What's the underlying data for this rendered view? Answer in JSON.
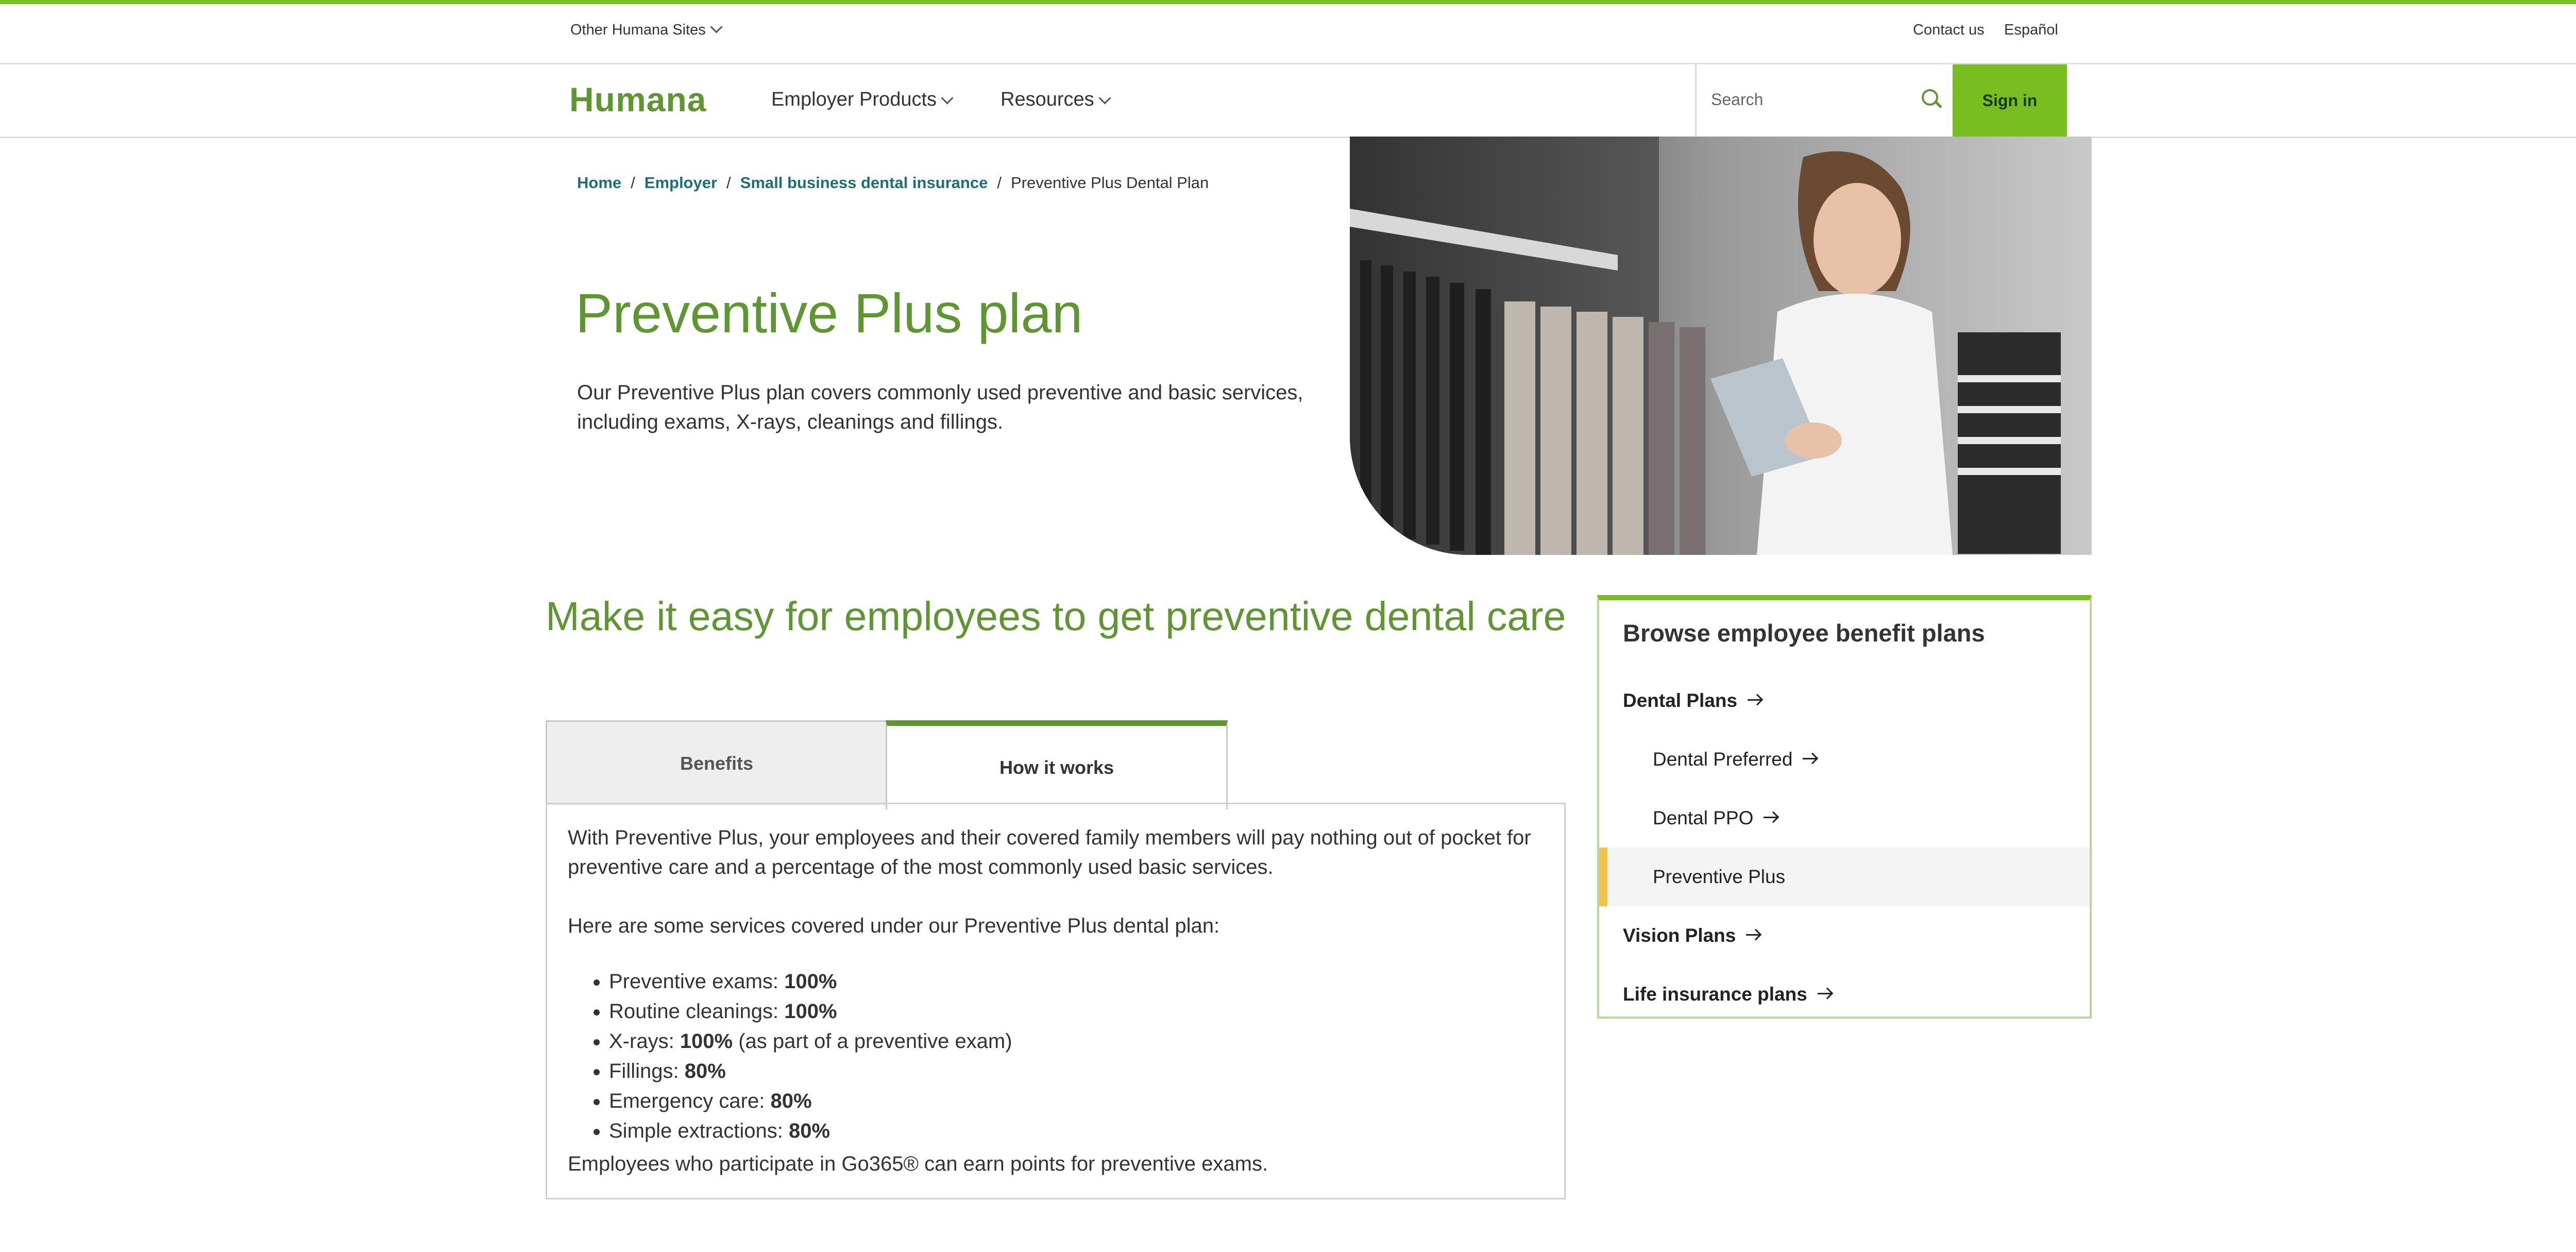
{
  "utility": {
    "other_sites": "Other Humana Sites",
    "contact": "Contact us",
    "language": "Español"
  },
  "nav": {
    "logo": "Humana",
    "employer_products": "Employer Products",
    "resources": "Resources",
    "search_placeholder": "Search",
    "sign_in": "Sign in"
  },
  "breadcrumb": {
    "home": "Home",
    "employer": "Employer",
    "small_business": "Small business dental insurance",
    "current": "Preventive Plus Dental Plan",
    "sep": "/"
  },
  "hero": {
    "title": "Preventive Plus plan",
    "description": "Our Preventive Plus plan covers commonly used preventive and basic services, including exams, X-rays, cleanings and fillings."
  },
  "section": {
    "title": "Make it easy for employees to get preventive dental care"
  },
  "tabs": {
    "benefits": "Benefits",
    "how_it_works": "How it works",
    "active": "How it works"
  },
  "panel": {
    "intro": "With Preventive Plus, your employees and their covered family members will pay nothing out of pocket for preventive care and a percentage of the most commonly used basic services.",
    "list_intro": "Here are some services covered under our Preventive Plus dental plan:",
    "items": [
      {
        "label": "Preventive exams: ",
        "value": "100%",
        "suffix": ""
      },
      {
        "label": "Routine cleanings: ",
        "value": "100%",
        "suffix": ""
      },
      {
        "label": "X-rays: ",
        "value": "100%",
        "suffix": " (as part of a preventive exam)"
      },
      {
        "label": "Fillings: ",
        "value": "80%",
        "suffix": ""
      },
      {
        "label": "Emergency care: ",
        "value": "80%",
        "suffix": ""
      },
      {
        "label": "Simple extractions: ",
        "value": "80%",
        "suffix": ""
      }
    ],
    "footer": "Employees who participate in Go365® can earn points for preventive exams."
  },
  "sidebar": {
    "title": "Browse employee benefit plans",
    "items": [
      {
        "label": "Dental Plans"
      },
      {
        "label": "Dental Preferred"
      },
      {
        "label": "Dental PPO"
      },
      {
        "label": "Preventive Plus"
      },
      {
        "label": "Vision Plans"
      },
      {
        "label": "Life insurance plans"
      }
    ]
  },
  "colors": {
    "brand_green": "#78be20",
    "heading_green": "#5e9732",
    "link_teal": "#1d6f77",
    "active_marker": "#f2c14e"
  }
}
